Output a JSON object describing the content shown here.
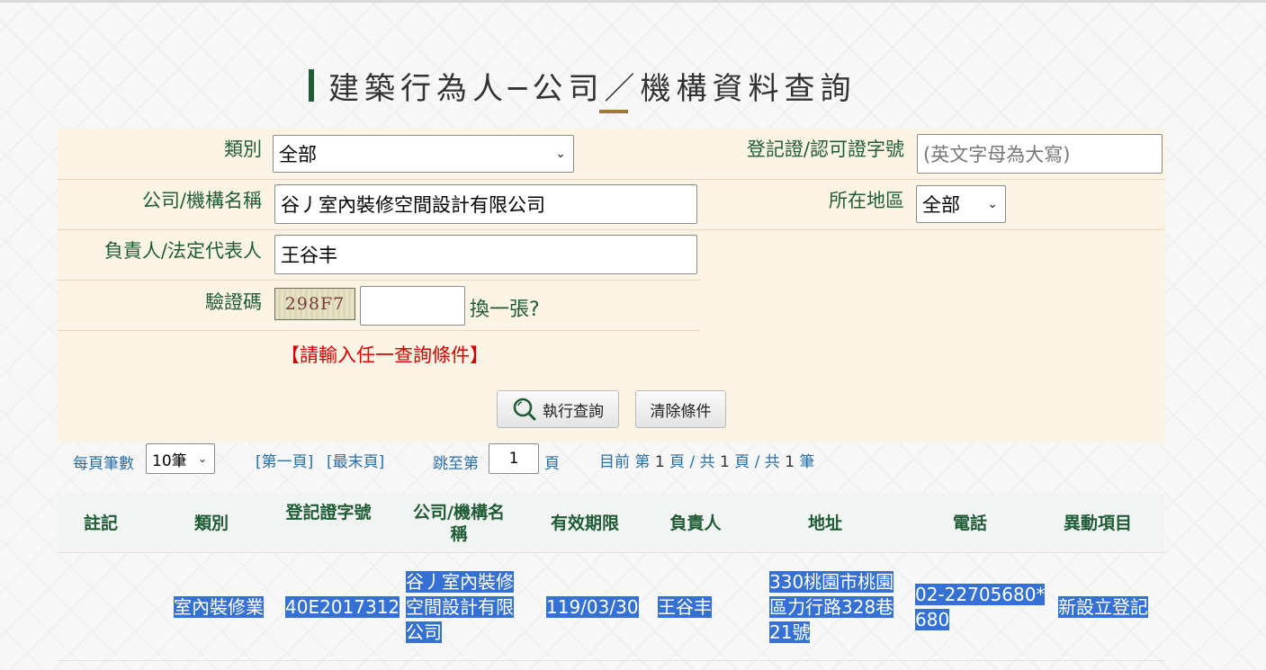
{
  "page": {
    "title": "建築行為人─公司／機構資料查詢"
  },
  "form": {
    "category_label": "類別",
    "category_value": "全部",
    "license_label": "登記證/認可證字號",
    "license_placeholder": "(英文字母為大寫)",
    "company_label": "公司/機構名稱",
    "company_value": "谷丿室內裝修空間設計有限公司",
    "region_label": "所在地區",
    "region_value": "全部",
    "owner_label": "負責人/法定代表人",
    "owner_value": "王谷丰",
    "captcha_label": "驗證碼",
    "captcha_text": "298F7",
    "captcha_value": "",
    "captcha_refresh": "換一張?",
    "hint": "【請輸入任一查詢條件】",
    "search_button": "執行查詢",
    "clear_button": "清除條件"
  },
  "pager": {
    "per_page_label": "每頁筆數",
    "per_page_value": "10筆",
    "first_page": "[第一頁]",
    "last_page": "[最末頁]",
    "jump_label": "跳至第",
    "jump_value": "1",
    "jump_unit": "頁",
    "current_prefix": "目前 第",
    "current_page": "1",
    "page_unit": "頁 / 共",
    "total_pages": "1",
    "total_records_prefix": "頁 / 共",
    "total_records": "1",
    "record_unit": "筆"
  },
  "table": {
    "headers": [
      "註記",
      "類別",
      "登記證字號",
      "公司/機構名稱",
      "有效期限",
      "負責人",
      "地址",
      "電話",
      "異動項目"
    ],
    "rows": [
      {
        "note": "",
        "category": "室內裝修業",
        "license": "40E2017312",
        "company": "谷丿室內裝修空間設計有限公司",
        "expiry": "119/03/30",
        "owner": "王谷丰",
        "address": "330桃園市桃園區力行路328巷21號",
        "phone": "02-22705680*680",
        "change": "新設立登記"
      }
    ]
  },
  "colors": {
    "accent": "#1f5c35",
    "gold": "#a0763a",
    "warning": "#d40000",
    "link": "#2a6fa8",
    "selection": "#3570d4"
  }
}
